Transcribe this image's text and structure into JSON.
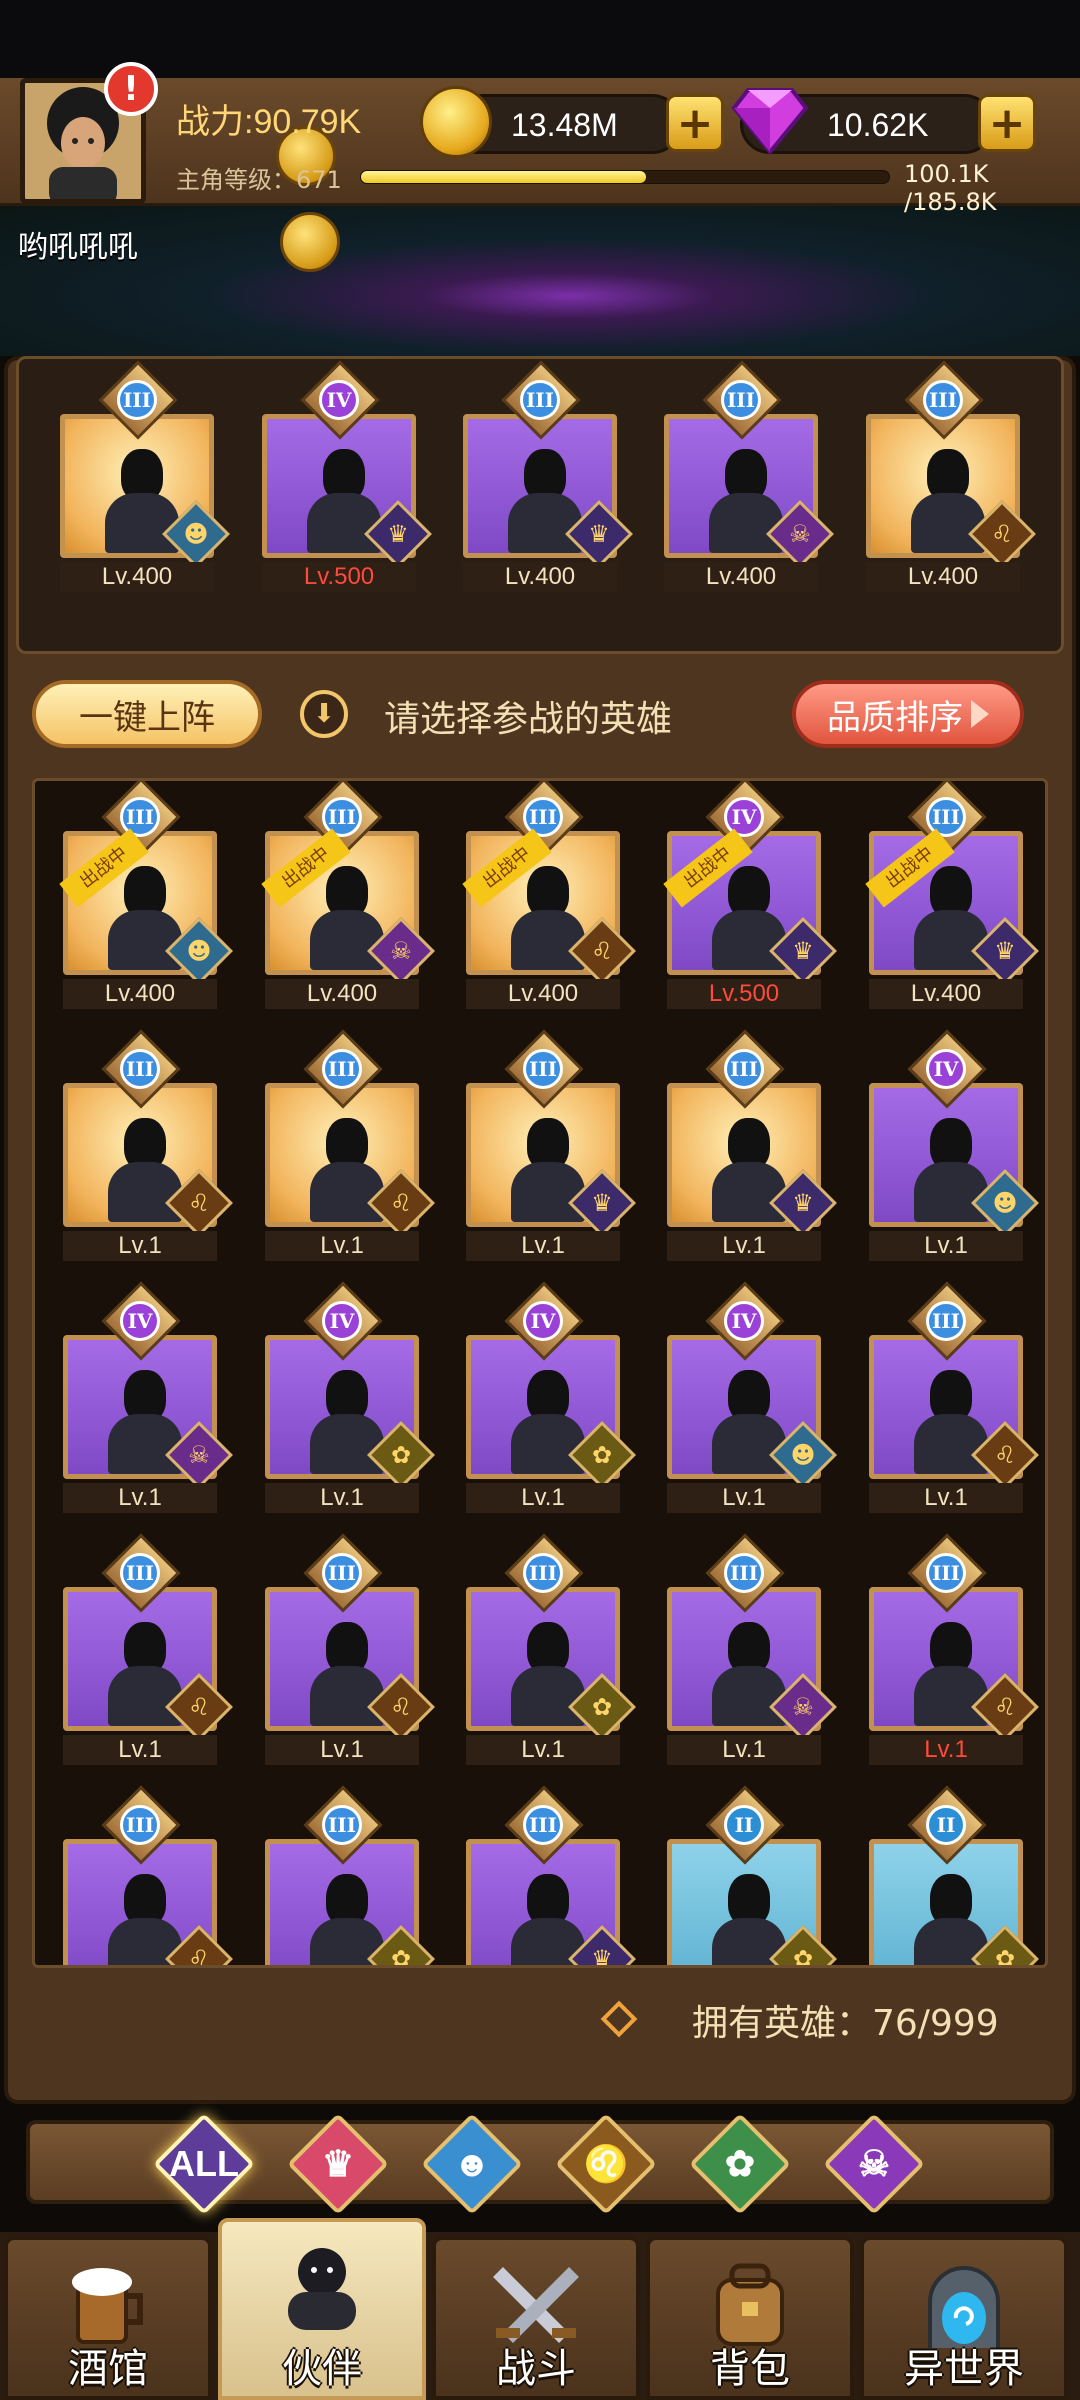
{
  "header": {
    "power_label": "战力:90.79K",
    "level_label": "主角等级：671",
    "xp_text": "100.1K /185.8K",
    "xp_fraction": 0.54,
    "gold": "13.48M",
    "gems": "10.62K",
    "player_name": "哟吼吼吼",
    "plus_label": "+",
    "alert_label": "!"
  },
  "lineup": [
    {
      "rank": "III",
      "level": "Lv.400",
      "bg": "gold",
      "faction": "goblin"
    },
    {
      "rank": "IV",
      "level": "Lv.500",
      "bg": "purple",
      "faction": "crown",
      "level_red": true
    },
    {
      "rank": "III",
      "level": "Lv.400",
      "bg": "purple",
      "faction": "crown"
    },
    {
      "rank": "III",
      "level": "Lv.400",
      "bg": "purple",
      "faction": "demon"
    },
    {
      "rank": "III",
      "level": "Lv.400",
      "bg": "gold",
      "faction": "lion"
    }
  ],
  "toolbar": {
    "one_click_label": "一键上阵",
    "hint": "请选择参战的英雄",
    "sort_label": "品质排序"
  },
  "tag_label": "出战中",
  "heroes": [
    {
      "rank": "III",
      "level": "Lv.400",
      "bg": "gold",
      "faction": "goblin",
      "deployed": true
    },
    {
      "rank": "III",
      "level": "Lv.400",
      "bg": "gold",
      "faction": "demon",
      "deployed": true
    },
    {
      "rank": "III",
      "level": "Lv.400",
      "bg": "gold",
      "faction": "lion",
      "deployed": true
    },
    {
      "rank": "IV",
      "level": "Lv.500",
      "bg": "purple",
      "faction": "crown",
      "deployed": true,
      "level_red": true
    },
    {
      "rank": "III",
      "level": "Lv.400",
      "bg": "purple",
      "faction": "crown",
      "deployed": true
    },
    {
      "rank": "III",
      "level": "Lv.1",
      "bg": "gold",
      "faction": "lion"
    },
    {
      "rank": "III",
      "level": "Lv.1",
      "bg": "gold",
      "faction": "lion"
    },
    {
      "rank": "III",
      "level": "Lv.1",
      "bg": "gold",
      "faction": "crown"
    },
    {
      "rank": "III",
      "level": "Lv.1",
      "bg": "gold",
      "faction": "crown"
    },
    {
      "rank": "IV",
      "level": "Lv.1",
      "bg": "purple",
      "faction": "goblin"
    },
    {
      "rank": "IV",
      "level": "Lv.1",
      "bg": "purple",
      "faction": "demon"
    },
    {
      "rank": "IV",
      "level": "Lv.1",
      "bg": "purple",
      "faction": "elf"
    },
    {
      "rank": "IV",
      "level": "Lv.1",
      "bg": "purple",
      "faction": "elf"
    },
    {
      "rank": "IV",
      "level": "Lv.1",
      "bg": "purple",
      "faction": "goblin"
    },
    {
      "rank": "III",
      "level": "Lv.1",
      "bg": "purple",
      "faction": "lion"
    },
    {
      "rank": "III",
      "level": "Lv.1",
      "bg": "purple",
      "faction": "lion"
    },
    {
      "rank": "III",
      "level": "Lv.1",
      "bg": "purple",
      "faction": "lion"
    },
    {
      "rank": "III",
      "level": "Lv.1",
      "bg": "purple",
      "faction": "elf"
    },
    {
      "rank": "III",
      "level": "Lv.1",
      "bg": "purple",
      "faction": "demon"
    },
    {
      "rank": "III",
      "level": "Lv.1",
      "bg": "purple",
      "faction": "lion",
      "level_red": true
    },
    {
      "rank": "III",
      "level": "",
      "bg": "purple",
      "faction": "lion"
    },
    {
      "rank": "III",
      "level": "",
      "bg": "purple",
      "faction": "elf"
    },
    {
      "rank": "III",
      "level": "",
      "bg": "purple",
      "faction": "crown"
    },
    {
      "rank": "II",
      "level": "",
      "bg": "blue",
      "faction": "elf"
    },
    {
      "rank": "II",
      "level": "",
      "bg": "blue",
      "faction": "elf"
    }
  ],
  "owned_label": "拥有英雄：76/999",
  "filters": [
    {
      "label": "ALL",
      "name": "all",
      "active": true
    },
    {
      "label": "",
      "name": "crown",
      "color": "#d94a6a"
    },
    {
      "label": "",
      "name": "goblin",
      "color": "#3a8fd0"
    },
    {
      "label": "",
      "name": "lion",
      "color": "#8a5a1e"
    },
    {
      "label": "",
      "name": "elf",
      "color": "#3e8f4a"
    },
    {
      "label": "",
      "name": "demon",
      "color": "#8a3ab8"
    }
  ],
  "nav": [
    {
      "label": "酒馆",
      "name": "tavern"
    },
    {
      "label": "伙伴",
      "name": "partners",
      "active": true
    },
    {
      "label": "战斗",
      "name": "battle"
    },
    {
      "label": "背包",
      "name": "backpack"
    },
    {
      "label": "异世界",
      "name": "other-world"
    }
  ],
  "colors": {
    "panel": "#4d3520",
    "gold_frame": "#f2b45c",
    "purple_frame": "#8f58d8",
    "blue_frame": "#72c2e0",
    "level_red": "#ff4a3c",
    "sort_button": "#e1553e",
    "one_click_button": "#f5c366"
  }
}
